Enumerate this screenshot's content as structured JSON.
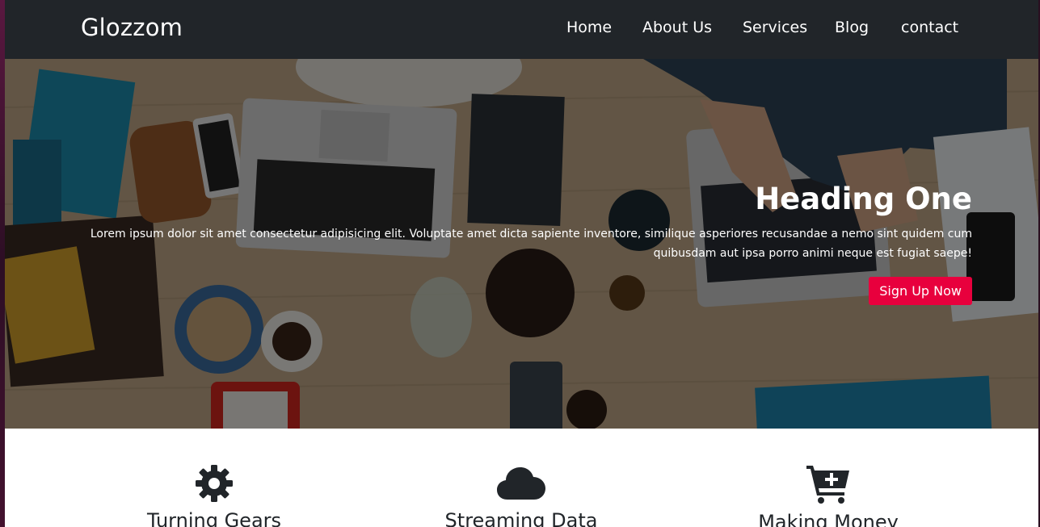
{
  "navbar": {
    "brand": "Glozzom",
    "links": [
      {
        "label": "Home"
      },
      {
        "label": "About Us"
      },
      {
        "label": "Services"
      },
      {
        "label": "Blog"
      },
      {
        "label": "contact"
      }
    ]
  },
  "hero": {
    "heading": "Heading One",
    "text": "Lorem ipsum dolor sit amet consectetur adipisicing elit. Voluptate amet dicta sapiente inventore, similique asperiores recusandae a nemo sint quidem cum quibusdam aut ipsa porro animi neque est fugiat saepe!",
    "button_label": "Sign Up Now",
    "button_color": "#e8003d"
  },
  "features": [
    {
      "icon": "gear-icon",
      "title": "Turning Gears"
    },
    {
      "icon": "cloud-icon",
      "title": "Streaming Data"
    },
    {
      "icon": "cart-plus-icon",
      "title": "Making Money"
    }
  ],
  "colors": {
    "navbar_bg": "#212529",
    "accent": "#e8003d"
  }
}
